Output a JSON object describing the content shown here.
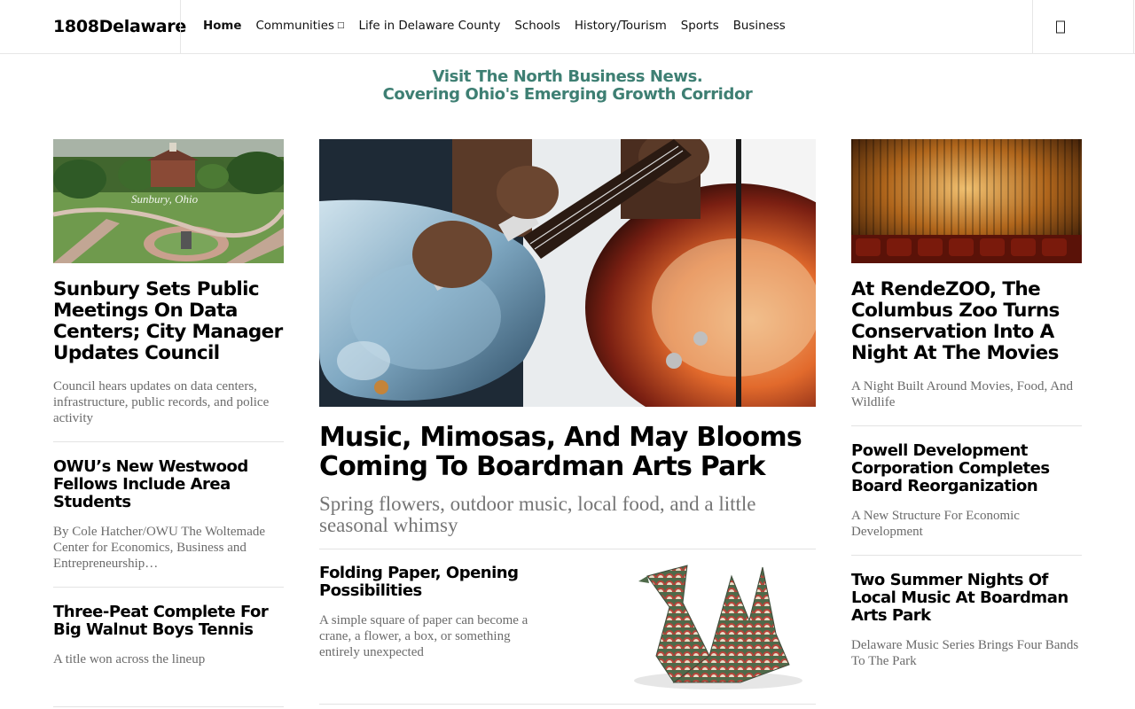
{
  "site": {
    "logo": "1808Delaware"
  },
  "nav": {
    "items": [
      {
        "label": "Home",
        "active": true
      },
      {
        "label": "Communities",
        "has_dropdown": true
      },
      {
        "label": "Life in Delaware County"
      },
      {
        "label": "Schools"
      },
      {
        "label": "History/Tourism"
      },
      {
        "label": "Sports"
      },
      {
        "label": "Business"
      }
    ],
    "search_icon": "search-icon"
  },
  "promo": {
    "line1": "Visit The North Business News.",
    "line2": "Covering Ohio's Emerging Growth Corridor",
    "color": "#3e7f73"
  },
  "left_column": {
    "feature": {
      "image_caption": "Sunbury, Ohio",
      "title": "Sunbury Sets Public Meetings On Data Centers; City Manager Updates Council",
      "excerpt": "Council hears updates on data centers, infrastructure, public records, and police activity"
    },
    "stories": [
      {
        "title": "OWU’s New Westwood Fellows Include Area Students",
        "excerpt": "By Cole Hatcher/OWU The Woltemade Center for Economics, Business and Entrepreneurship…"
      },
      {
        "title": "Three-Peat Complete For Big Walnut Boys Tennis",
        "excerpt": "A title won across the lineup"
      }
    ]
  },
  "middle_column": {
    "feature": {
      "title": "Music, Mimosas, And May Blooms Coming To Boardman Arts Park",
      "excerpt": "Spring flowers, outdoor music, local food, and a little seasonal whimsy"
    },
    "story": {
      "title": "Folding Paper, Opening Possibilities",
      "excerpt": "A simple square of paper can become a crane, a flower, a box, or something entirely unexpected"
    }
  },
  "right_column": {
    "feature": {
      "title": "At RendeZOO, The Columbus Zoo Turns Conservation Into A Night At The Movies",
      "excerpt": "A Night Built Around Movies, Food, And Wildlife"
    },
    "stories": [
      {
        "title": "Powell Development Corporation Completes Board Reorganization",
        "excerpt": "A New Structure For Economic Development"
      },
      {
        "title": "Two Summer Nights Of Local Music At Boardman Arts Park",
        "excerpt": "Delaware Music Series Brings Four Bands To The Park"
      }
    ]
  }
}
